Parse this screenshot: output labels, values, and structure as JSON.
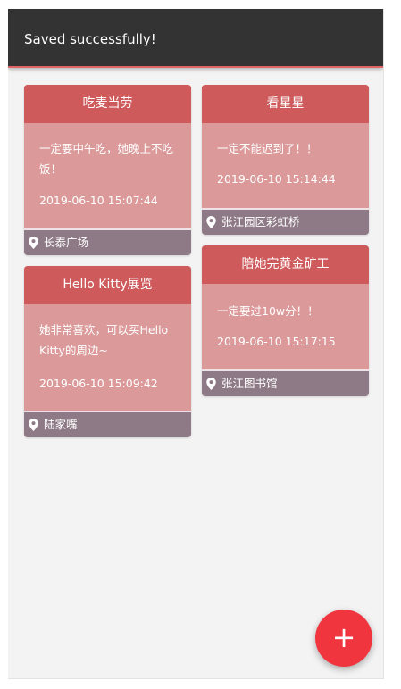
{
  "snackbar": {
    "message": "Saved successfully!"
  },
  "cards": [
    {
      "title": "吃麦当劳",
      "note": "一定要中午吃，她晚上不吃饭！",
      "time": "2019-06-10 15:07:44",
      "location": "长泰广场"
    },
    {
      "title": "Hello Kitty展览",
      "note": "她非常喜欢，可以买Hello Kitty的周边~",
      "time": "2019-06-10 15:09:42",
      "location": "陆家嘴"
    },
    {
      "title": "看星星",
      "note": "一定不能迟到了！！",
      "time": "2019-06-10 15:14:44",
      "location": "张江园区彩虹桥"
    },
    {
      "title": "陪她完黄金矿工",
      "note": "一定要过10w分！！",
      "time": "2019-06-10 15:17:15",
      "location": "张江图书馆"
    }
  ],
  "fab": {
    "icon": "plus-icon",
    "glyph": "+"
  },
  "colors": {
    "snackbar": "#333333",
    "card_header": "#cf5a5c",
    "card_body": "#db999a",
    "card_footer": "#8e7a86",
    "fab": "#f0353f",
    "background": "#f3f3f3"
  }
}
